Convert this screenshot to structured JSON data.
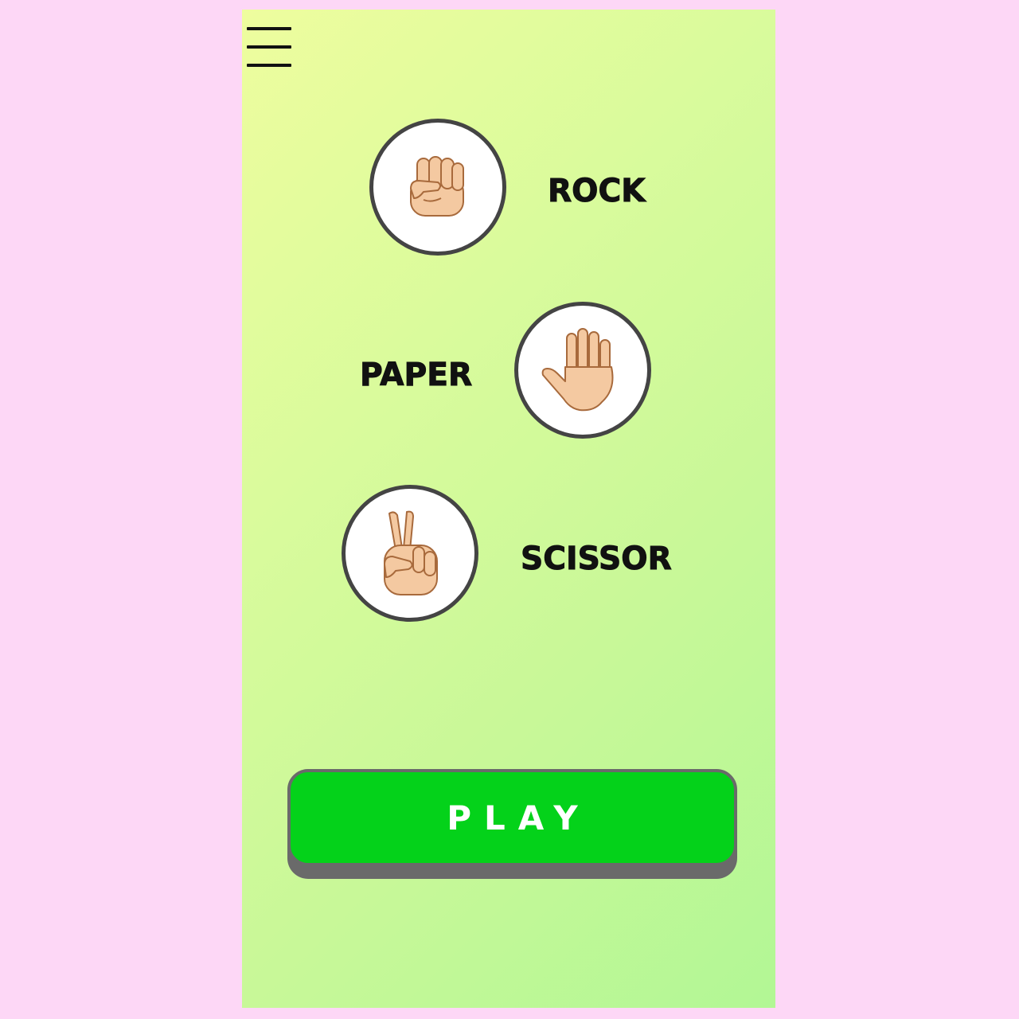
{
  "colors": {
    "page_background": "#fdd7f6",
    "screen_gradient_start": "#eefd9e",
    "screen_gradient_end": "#b2f795",
    "circle_border": "#444444",
    "play_button": "#04d21a",
    "play_button_shadow": "#6a6a6a",
    "skin": "#f4c9a1",
    "skin_outline": "#a86a3c"
  },
  "header": {
    "menu_icon": "hamburger-menu-icon"
  },
  "choices": [
    {
      "label": "ROCK",
      "icon": "raised-fist-icon"
    },
    {
      "label": "PAPER",
      "icon": "open-hand-icon"
    },
    {
      "label": "SCISSOR",
      "icon": "victory-hand-icon"
    }
  ],
  "play_button": {
    "label": "PLAY"
  }
}
